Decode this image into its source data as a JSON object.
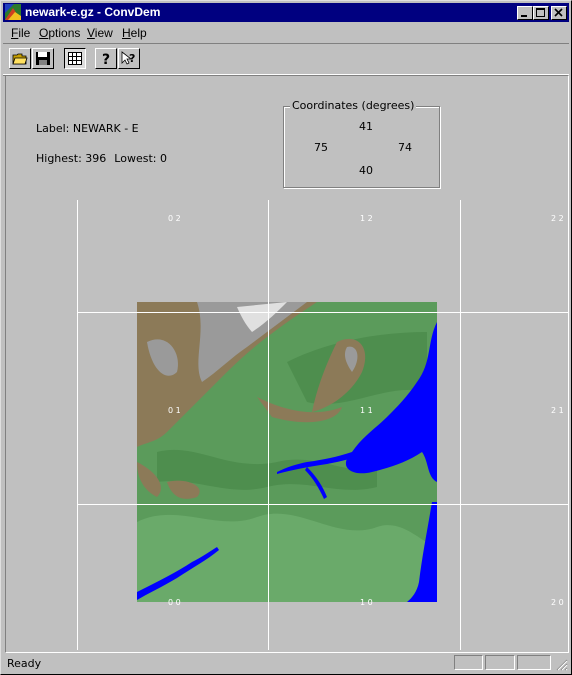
{
  "window": {
    "title": "newark-e.gz - ConvDem"
  },
  "menu": {
    "items": [
      {
        "label": "File",
        "underline": "F",
        "rest": "ile"
      },
      {
        "label": "Options",
        "underline": "O",
        "rest": "ptions"
      },
      {
        "label": "View",
        "underline": "V",
        "rest": "iew"
      },
      {
        "label": "Help",
        "underline": "H",
        "rest": "elp"
      }
    ]
  },
  "toolbar": {
    "buttons": [
      {
        "name": "open-button",
        "icon": "folder-open-icon"
      },
      {
        "name": "save-button",
        "icon": "floppy-disk-icon"
      },
      {
        "name": "grid-toggle-button",
        "icon": "grid-icon",
        "pressed": true
      },
      {
        "name": "about-button",
        "icon": "question-mark-icon"
      },
      {
        "name": "context-help-button",
        "icon": "pointer-help-icon"
      }
    ]
  },
  "info": {
    "label_text": "Label: NEWARK - E",
    "highest_text": "Highest: 396",
    "lowest_text": "Lowest: 0"
  },
  "coordinates": {
    "title": "Coordinates (degrees)",
    "north": "41",
    "west": "75",
    "east": "74",
    "south": "40"
  },
  "grid": {
    "labels": {
      "r2c0": "0 2",
      "r2c1": "1 2",
      "r2c2": "2 2",
      "r1c0": "0 1",
      "r1c1": "1 1",
      "r1c2": "2 1",
      "r0c0": "0 0",
      "r0c1": "1 0",
      "r0c2": "2 0"
    }
  },
  "status": {
    "text": "Ready"
  },
  "colors": {
    "titlebar": "#000080",
    "water": "#0000ff",
    "lowland": "#5a9a5a",
    "midland": "#4a8a4a",
    "highland": "#8c7a58",
    "peak": "#9a9a9a"
  }
}
